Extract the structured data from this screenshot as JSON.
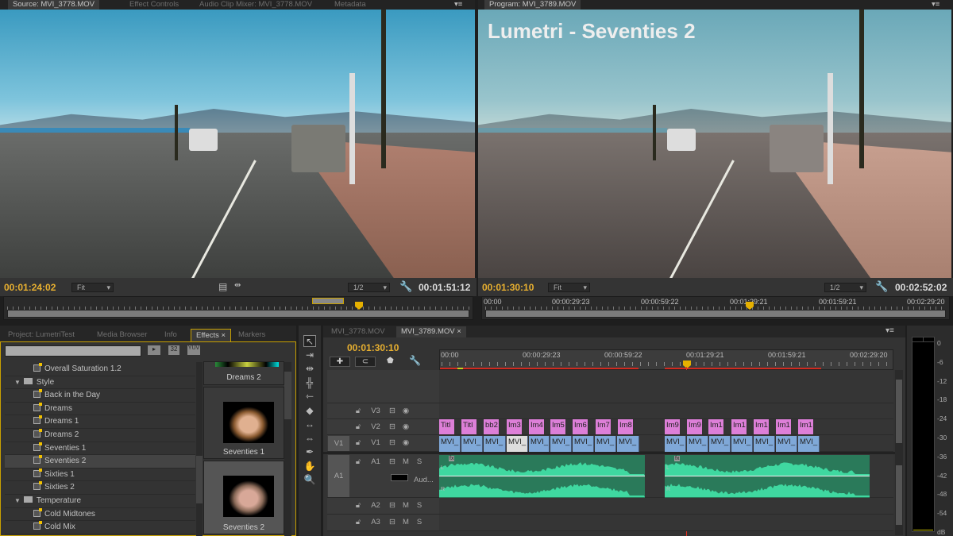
{
  "source_monitor": {
    "tabs": [
      "Source: MVI_3778.MOV",
      "Effect Controls",
      "Audio Clip Mixer: MVI_3778.MOV",
      "Metadata"
    ],
    "timecode": "00:01:24:02",
    "fit": "Fit",
    "resolution": "1/2",
    "duration": "00:01:51:12"
  },
  "program_monitor": {
    "tab": "Program: MVI_3789.MOV",
    "overlay_title": "Lumetri - Seventies 2",
    "timecode": "00:01:30:10",
    "fit": "Fit",
    "resolution": "1/2",
    "duration": "00:02:52:02",
    "ruler": [
      "00:00",
      "00:00:29:23",
      "00:00:59:22",
      "00:01:29:21",
      "00:01:59:21",
      "00:02:29:20"
    ]
  },
  "effects_panel": {
    "tabs": [
      "Project: LumetriTest",
      "Media Browser",
      "Info",
      "Effects",
      "Markers"
    ],
    "search_placeholder": "",
    "filter_buttons": [
      "accelerated-icon",
      "32-bit-icon",
      "YUV"
    ],
    "items": [
      {
        "label": "Overall Saturation 1.2",
        "type": "preset"
      },
      {
        "label": "Style",
        "type": "folder"
      },
      {
        "label": "Back in the Day",
        "type": "preset"
      },
      {
        "label": "Dreams",
        "type": "preset"
      },
      {
        "label": "Dreams 1",
        "type": "preset"
      },
      {
        "label": "Dreams 2",
        "type": "preset"
      },
      {
        "label": "Seventies 1",
        "type": "preset"
      },
      {
        "label": "Seventies 2",
        "type": "preset",
        "selected": true
      },
      {
        "label": "Sixties 1",
        "type": "preset"
      },
      {
        "label": "Sixties 2",
        "type": "preset"
      },
      {
        "label": "Temperature",
        "type": "folder"
      },
      {
        "label": "Cold Midtones",
        "type": "preset"
      },
      {
        "label": "Cold Mix",
        "type": "preset"
      }
    ],
    "previews": [
      "Dreams 2",
      "Seventies 1",
      "Seventies 2"
    ]
  },
  "tools": [
    "selection-icon",
    "track-select-icon",
    "ripple-edit-icon",
    "rolling-edit-icon",
    "rate-stretch-icon",
    "razor-icon",
    "slip-icon",
    "slide-icon",
    "pen-icon",
    "hand-icon",
    "zoom-icon"
  ],
  "timeline": {
    "tabs": [
      "MVI_3778.MOV",
      "MVI_3789.MOV"
    ],
    "timecode": "00:01:30:10",
    "ruler": [
      "00:00",
      "00:00:29:23",
      "00:00:59:22",
      "00:01:29:21",
      "00:01:59:21",
      "00:02:29:20"
    ],
    "tracks": {
      "video": [
        {
          "name": "V3"
        },
        {
          "name": "V2"
        },
        {
          "name": "V1",
          "source": "V1"
        }
      ],
      "audio": [
        {
          "name": "A1",
          "source": "A1",
          "clip": "Aud..."
        },
        {
          "name": "A2"
        },
        {
          "name": "A3"
        }
      ],
      "mute": "M",
      "solo": "S"
    },
    "v2_clips": [
      "Titl",
      "Titl",
      "bb2",
      "Im3",
      "Im4",
      "Im5",
      "Im6",
      "Im7",
      "Im8",
      "Im9",
      "Im9",
      "Im1",
      "Im1",
      "Im1",
      "Im1",
      "Im1"
    ],
    "v1_clips": [
      "MVI_",
      "MVI_",
      "MVI_",
      "MVI_",
      "MVI_",
      "MVI_",
      "MVI_",
      "MVI_",
      "MVI_",
      "MVI_",
      "MVI_",
      "MVI_",
      "MVI_",
      "MVI_",
      "MVI_",
      "MVI_"
    ],
    "audio_channels": [
      "L",
      "R"
    ],
    "fx_badge": "fx"
  },
  "audio_meter": {
    "labels": [
      "0",
      "-6",
      "-12",
      "-18",
      "-24",
      "-30",
      "-36",
      "-42",
      "-48",
      "-54",
      "dB"
    ]
  },
  "colors": {
    "timecode": "#e8b030",
    "playhead": "#e03020",
    "video_clip": "#7fa8d8",
    "title_clip": "#dd7fd8",
    "audio_clip": "#2a7a5a",
    "waveform": "#3fd8a0"
  }
}
